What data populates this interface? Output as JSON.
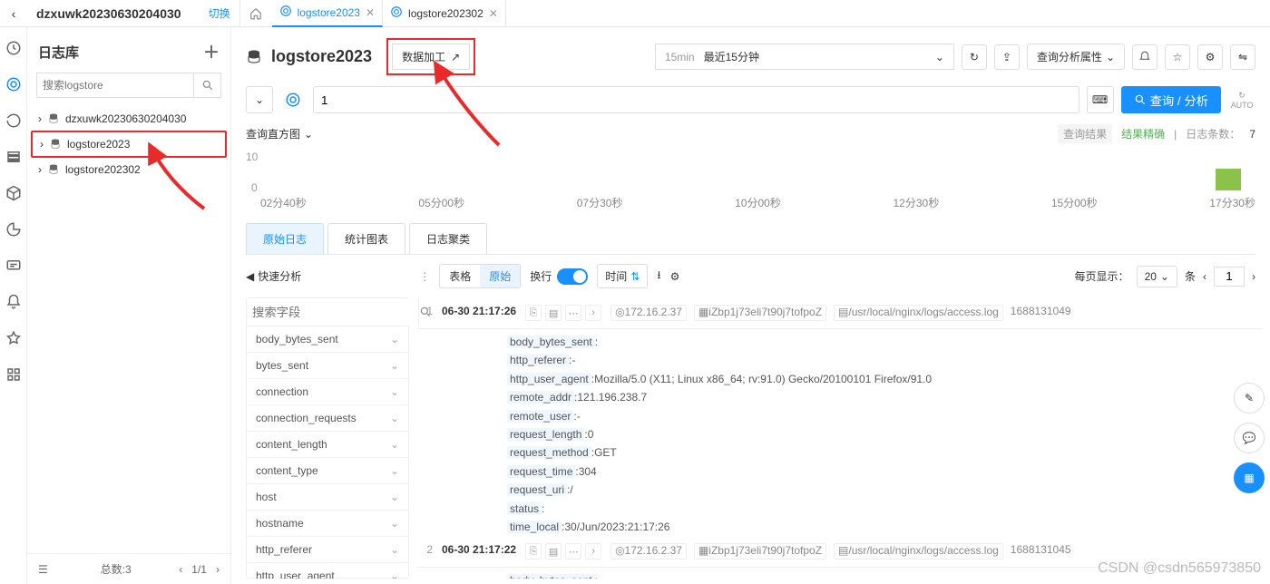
{
  "topbar": {
    "title": "dzxuwk20230630204030",
    "switch": "切换"
  },
  "tabs": [
    {
      "label": "logstore2023",
      "active": true
    },
    {
      "label": "logstore202302",
      "active": false
    }
  ],
  "sidebar": {
    "title": "日志库",
    "search_placeholder": "搜索logstore",
    "items": [
      {
        "label": "dzxuwk20230630204030",
        "selected": false
      },
      {
        "label": "logstore2023",
        "selected": true
      },
      {
        "label": "logstore202302",
        "selected": false
      }
    ],
    "footer": {
      "total_label": "总数:3",
      "page": "1/1"
    }
  },
  "main": {
    "title": "logstore2023",
    "data_process": "数据加工",
    "time": {
      "preset": "15min",
      "label": "最近15分钟"
    },
    "query_attr": "查询分析属性",
    "auto_label": "AUTO"
  },
  "query": {
    "value": "1",
    "button": "查询 / 分析"
  },
  "hist": {
    "label": "查询直方图",
    "result_label": "查询结果",
    "accuracy": "结果精确",
    "count_label": "日志条数：",
    "count": "7"
  },
  "chart_data": {
    "type": "bar",
    "categories": [
      "02分40秒",
      "05分00秒",
      "07分30秒",
      "10分00秒",
      "12分30秒",
      "15分00秒",
      "17分30秒"
    ],
    "values": [
      0,
      0,
      0,
      0,
      0,
      0,
      7
    ],
    "y_ticks": [
      0,
      10
    ],
    "title": "",
    "xlabel": "",
    "ylabel": "",
    "ylim": [
      0,
      10
    ]
  },
  "result_tabs": {
    "raw": "原始日志",
    "stats": "统计图表",
    "cluster": "日志聚类"
  },
  "controls": {
    "quick": "快速分析",
    "view_table": "表格",
    "view_raw": "原始",
    "wrap": "换行",
    "time": "时间",
    "per_page_label": "每页显示：",
    "per_page": "20",
    "unit": "条",
    "page": "1"
  },
  "fields": {
    "search_placeholder": "搜索字段",
    "list": [
      "body_bytes_sent",
      "bytes_sent",
      "connection",
      "connection_requests",
      "content_length",
      "content_type",
      "host",
      "hostname",
      "http_referer",
      "http_user_agent"
    ]
  },
  "logs": [
    {
      "idx": "1",
      "time": "06-30 21:17:26",
      "ip": "172.16.2.37",
      "host": "iZbp1j73eli7t90j7tofpoZ",
      "path": "/usr/local/nginx/logs/access.log",
      "ts": "1688131049",
      "kv": [
        [
          "body_bytes_sent",
          ":"
        ],
        [
          "http_referer",
          ":-"
        ],
        [
          "http_user_agent",
          ":Mozilla/5.0 (X11; Linux x86_64; rv:91.0) Gecko/20100101 Firefox/91.0"
        ],
        [
          "remote_addr",
          ":121.196.238.7"
        ],
        [
          "remote_user",
          ":-"
        ],
        [
          "request_length",
          ":0"
        ],
        [
          "request_method",
          ":GET"
        ],
        [
          "request_time",
          ":304"
        ],
        [
          "request_uri",
          ":/"
        ],
        [
          "status",
          ":"
        ],
        [
          "time_local",
          ":30/Jun/2023:21:17:26"
        ]
      ]
    },
    {
      "idx": "2",
      "time": "06-30 21:17:22",
      "ip": "172.16.2.37",
      "host": "iZbp1j73eli7t90j7tofpoZ",
      "path": "/usr/local/nginx/logs/access.log",
      "ts": "1688131045",
      "kv": [
        [
          "body_bytes_sent",
          ":"
        ]
      ]
    }
  ],
  "watermark": "CSDN @csdn565973850"
}
